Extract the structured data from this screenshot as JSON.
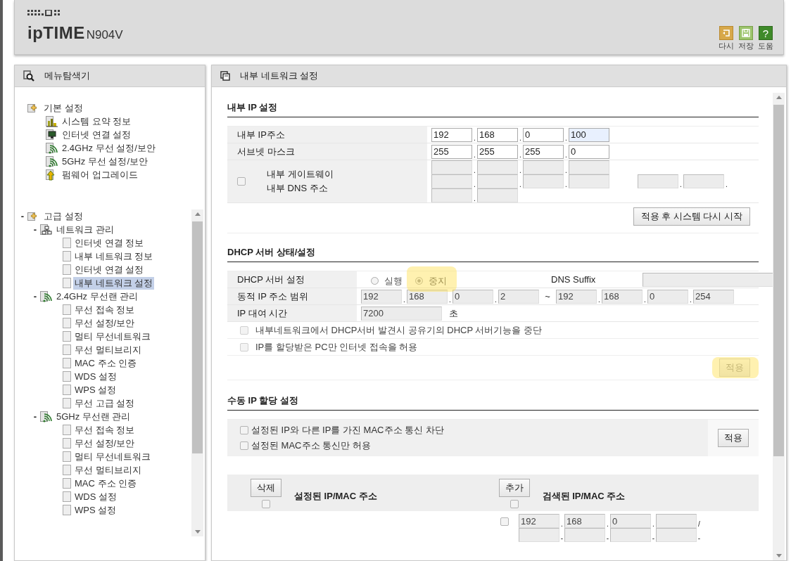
{
  "header": {
    "brand": "ipTIME",
    "model": "N904V",
    "actions": [
      {
        "kind": "reset",
        "label": "다시"
      },
      {
        "kind": "save",
        "label": "저장"
      },
      {
        "kind": "help",
        "symbol": "?",
        "label": "도움"
      }
    ]
  },
  "sidebar": {
    "title": "메뉴탐색기",
    "tree": [
      {
        "label": "기본 설정",
        "kind": "folder",
        "children": [
          {
            "label": "시스템 요약 정보",
            "kind": "chart",
            "selected": false
          },
          {
            "label": "인터넷 연결 설정",
            "kind": "monitor",
            "selected": false
          },
          {
            "label": "2.4GHz 무선 설정/보안",
            "kind": "wifi",
            "selected": false
          },
          {
            "label": "5GHz 무선 설정/보안",
            "kind": "wifi",
            "selected": false
          },
          {
            "label": "펌웨어 업그레이드",
            "kind": "upgrade",
            "selected": false
          }
        ]
      },
      {
        "label": "고급 설정",
        "kind": "folder",
        "toggle": "-",
        "children": [
          {
            "label": "네트워크 관리",
            "kind": "network",
            "toggle": "-",
            "children": [
              {
                "label": "인터넷 연결 정보",
                "kind": "page",
                "selected": false
              },
              {
                "label": "내부 네트워크 정보",
                "kind": "page",
                "selected": false
              },
              {
                "label": "인터넷 연결 설정",
                "kind": "page",
                "selected": false
              },
              {
                "label": "내부 네트워크 설정",
                "kind": "page",
                "selected": true
              }
            ]
          },
          {
            "label": "2.4GHz 무선랜 관리",
            "kind": "wifi",
            "toggle": "-",
            "children": [
              {
                "label": "무선 접속 정보",
                "kind": "page",
                "selected": false
              },
              {
                "label": "무선 설정/보안",
                "kind": "page",
                "selected": false
              },
              {
                "label": "멀티 무선네트워크",
                "kind": "page",
                "selected": false
              },
              {
                "label": "무선 멀티브리지",
                "kind": "page",
                "selected": false
              },
              {
                "label": "MAC 주소 인증",
                "kind": "page",
                "selected": false
              },
              {
                "label": "WDS 설정",
                "kind": "page",
                "selected": false
              },
              {
                "label": "WPS 설정",
                "kind": "page",
                "selected": false
              },
              {
                "label": "무선 고급 설정",
                "kind": "page",
                "selected": false
              }
            ]
          },
          {
            "label": "5GHz 무선랜 관리",
            "kind": "wifi",
            "toggle": "-",
            "children": [
              {
                "label": "무선 접속 정보",
                "kind": "page",
                "selected": false
              },
              {
                "label": "무선 설정/보안",
                "kind": "page",
                "selected": false
              },
              {
                "label": "멀티 무선네트워크",
                "kind": "page",
                "selected": false
              },
              {
                "label": "무선 멀티브리지",
                "kind": "page",
                "selected": false
              },
              {
                "label": "MAC 주소 인증",
                "kind": "page",
                "selected": false
              },
              {
                "label": "WDS 설정",
                "kind": "page",
                "selected": false
              },
              {
                "label": "WPS 설정",
                "kind": "page",
                "selected": false
              }
            ]
          }
        ]
      }
    ]
  },
  "main": {
    "title": "내부 네트워크 설정",
    "lan": {
      "title": "내부 IP 설정",
      "separator": ".",
      "ip": {
        "label": "내부 IP주소",
        "octets": [
          {
            "value": "192",
            "focused": false
          },
          {
            "value": "168",
            "focused": false
          },
          {
            "value": "0",
            "focused": false
          },
          {
            "value": "100",
            "focused": true
          }
        ]
      },
      "mask": {
        "label": "서브넷 마스크",
        "octets": [
          "255",
          "255",
          "255",
          "0"
        ]
      },
      "gateway": {
        "checked": false,
        "disabled": true,
        "labels": [
          "내부 게이트웨이",
          "내부 DNS 주소"
        ]
      },
      "apply": {
        "label": "적용 후 시스템 다시 시작"
      }
    },
    "dhcp": {
      "title": "DHCP 서버 상태/설정",
      "separator": ".",
      "server": {
        "label": "DHCP 서버 설정",
        "options": [
          {
            "label": "실행",
            "selected": false,
            "highlighted": false
          },
          {
            "label": "중지",
            "selected": true,
            "highlighted": true
          }
        ]
      },
      "dns_suffix": {
        "label": "DNS Suffix",
        "disabled": true
      },
      "range": {
        "label": "동적 IP 주소 범위",
        "to": "~",
        "disabled": true,
        "start": [
          "192",
          "168",
          "0",
          "2"
        ],
        "end": [
          "192",
          "168",
          "0",
          "254"
        ]
      },
      "lease": {
        "label": "IP 대여 시간",
        "value": "7200",
        "unit": "초",
        "disabled": true
      },
      "options": [
        {
          "label": "내부네트워크에서 DHCP서버 발견시 공유기의 DHCP 서버기능을 중단",
          "checked": false,
          "disabled": true
        },
        {
          "label": "IP를 할당받은 PC만 인터넷 접속을 허용",
          "checked": false,
          "disabled": true
        }
      ],
      "apply": {
        "label": "적용",
        "disabled": true,
        "highlighted": true
      }
    },
    "manual": {
      "title": "수동 IP 할당 설정",
      "options": [
        {
          "label": "설정된 IP와 다른 IP를 가진 MAC주소 통신 차단",
          "checked": false
        },
        {
          "label": "설정된 MAC주소 통신만 허용",
          "checked": false
        }
      ],
      "apply": {
        "label": "적용",
        "disabled": false
      },
      "configured": {
        "button": "삭제",
        "checked": false,
        "heading": "설정된 IP/MAC 주소"
      },
      "discovered": {
        "button": "추가",
        "checked": false,
        "heading": "검색된 IP/MAC 주소",
        "rows": [
          {
            "checked": false,
            "ip": [
              "192",
              "168",
              "0"
            ],
            "ip_separator": ".",
            "slash": "/",
            "mac_separator": "-"
          }
        ]
      }
    }
  }
}
